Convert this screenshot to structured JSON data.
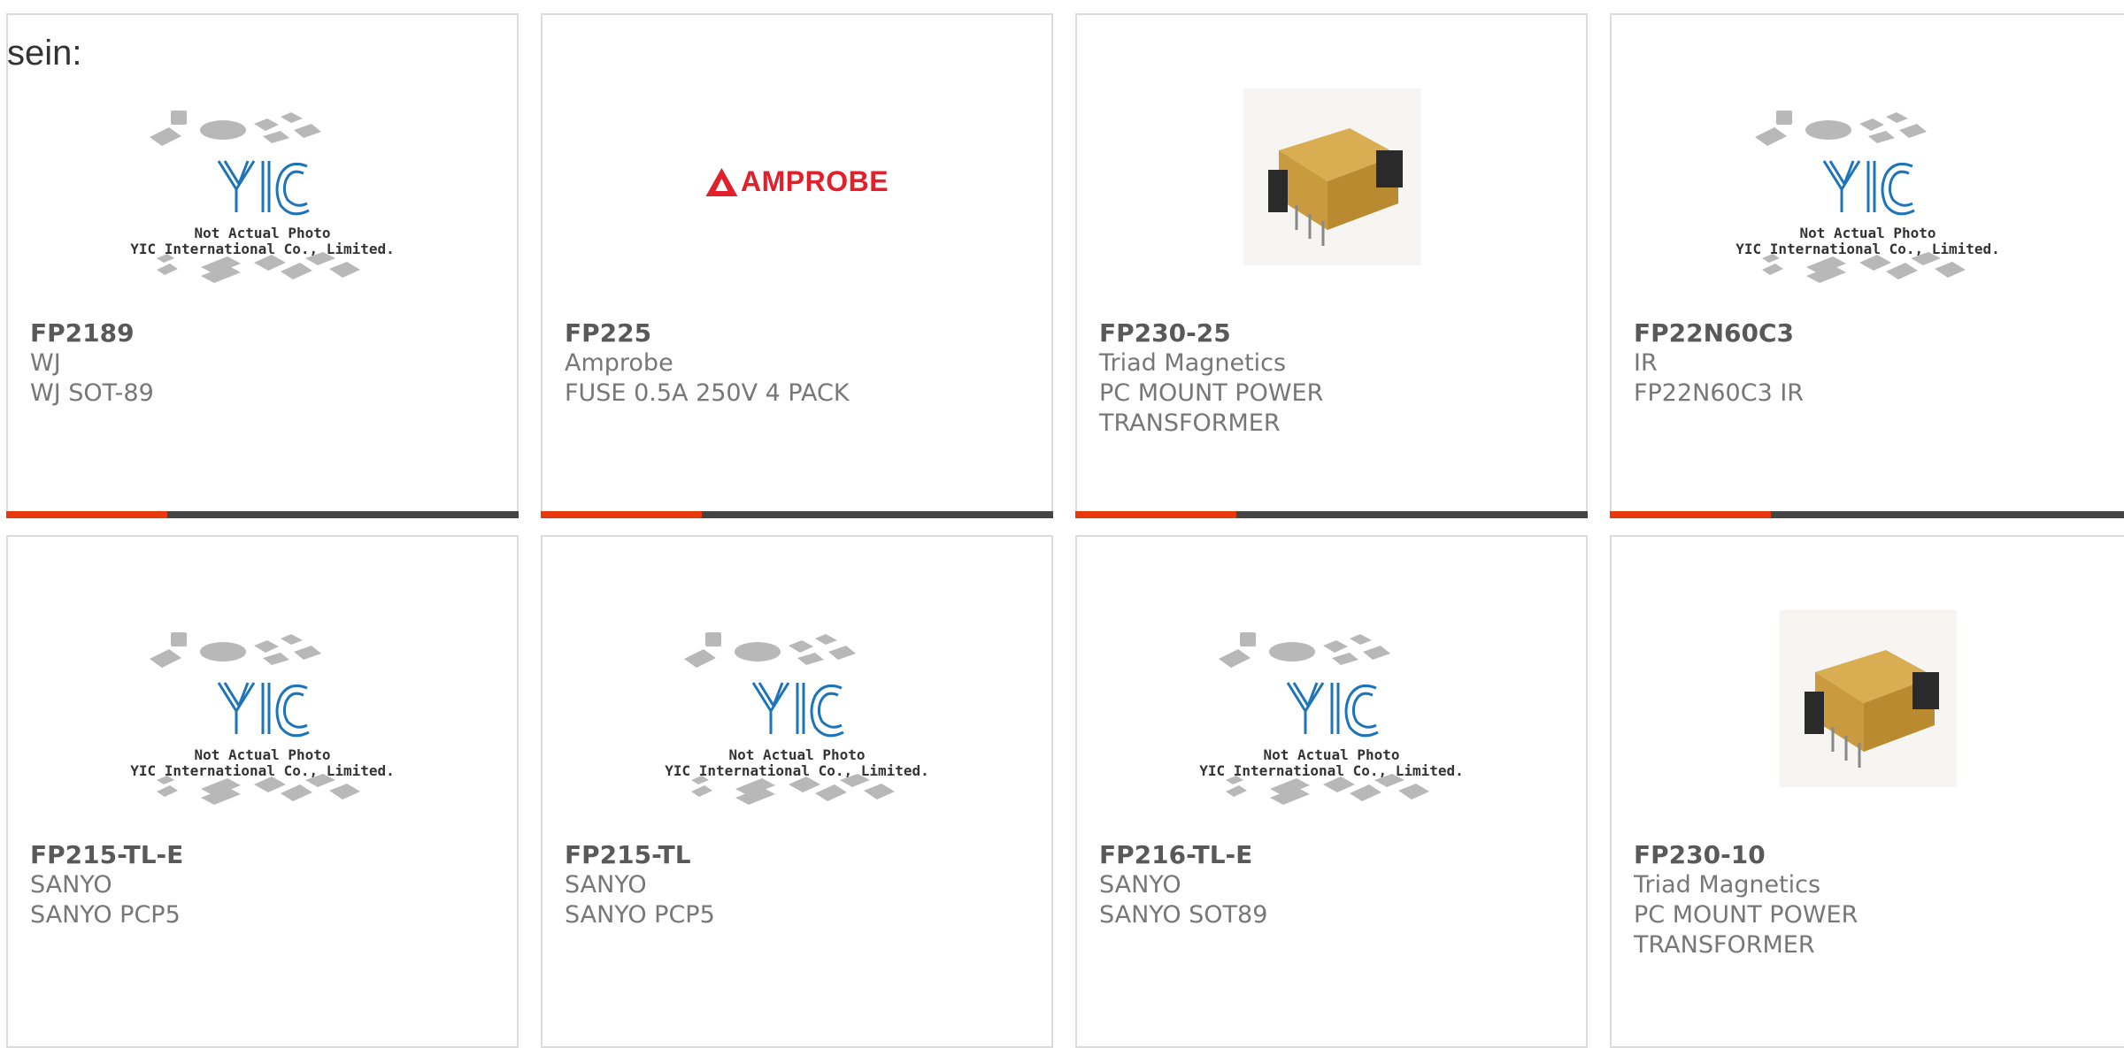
{
  "page": {
    "prefix_text": "sein:"
  },
  "placeholder": {
    "caption_line1": "Not Actual Photo",
    "caption_line2": "YIC International Co., Limited.",
    "logo_text": "YIC"
  },
  "brand_logo": {
    "amprobe_text": "AMPROBE"
  },
  "colors": {
    "accent": "#e8380d",
    "bar": "#444444",
    "border": "#dcdcdc",
    "logo_blue": "#1d74b8",
    "amprobe_red": "#e0202a"
  },
  "products": [
    {
      "part_number": "FP2189",
      "manufacturer": "WJ",
      "description": "WJ SOT-89",
      "image": "placeholder"
    },
    {
      "part_number": "FP225",
      "manufacturer": "Amprobe",
      "description": "FUSE 0.5A 250V 4 PACK",
      "image": "amprobe-logo"
    },
    {
      "part_number": "FP230-25",
      "manufacturer": "Triad Magnetics",
      "description": "PC MOUNT POWER TRANSFORMER",
      "image": "transformer-photo"
    },
    {
      "part_number": "FP22N60C3",
      "manufacturer": "IR",
      "description": "FP22N60C3 IR",
      "image": "placeholder"
    },
    {
      "part_number": "FP215-TL-E",
      "manufacturer": "SANYO",
      "description": "SANYO PCP5",
      "image": "placeholder"
    },
    {
      "part_number": "FP215-TL",
      "manufacturer": "SANYO",
      "description": "SANYO PCP5",
      "image": "placeholder"
    },
    {
      "part_number": "FP216-TL-E",
      "manufacturer": "SANYO",
      "description": "SANYO SOT89",
      "image": "placeholder"
    },
    {
      "part_number": "FP230-10",
      "manufacturer": "Triad Magnetics",
      "description": "PC MOUNT POWER TRANSFORMER",
      "image": "transformer-photo"
    }
  ]
}
